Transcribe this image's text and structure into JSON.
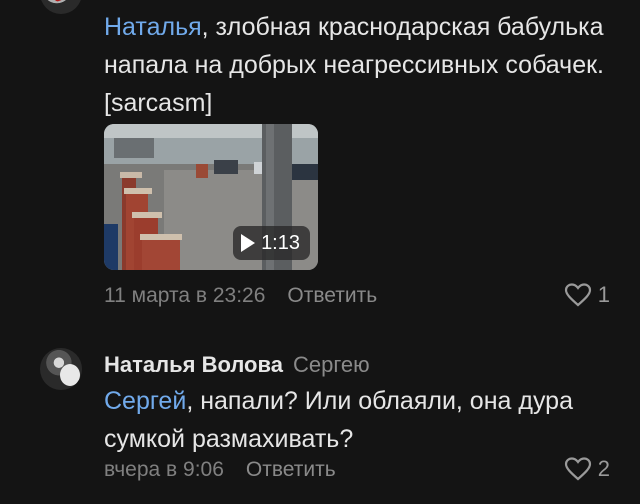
{
  "comment1": {
    "author_partial": "",
    "mention": "Наталья",
    "text_after_mention": ", злобная краснодарская бабулька напала на добрых неагрессивных собачек. [sarcasm]",
    "video": {
      "duration": "1:13"
    },
    "timestamp": "11 марта в 23:26",
    "reply_label": "Ответить",
    "likes": "1"
  },
  "comment2": {
    "author": "Наталья Волова",
    "reply_to": "Сергею",
    "mention": "Сергей",
    "text_after_mention": ", напали? Или облаяли, она дура сумкой размахивать?",
    "timestamp": "вчера в 9:06",
    "reply_label": "Ответить",
    "likes": "2"
  },
  "icons": {
    "like": "heart-outline-icon",
    "play": "play-icon"
  },
  "colors": {
    "background": "#141414",
    "mention": "#71aaeb",
    "secondary_text": "#808080"
  }
}
